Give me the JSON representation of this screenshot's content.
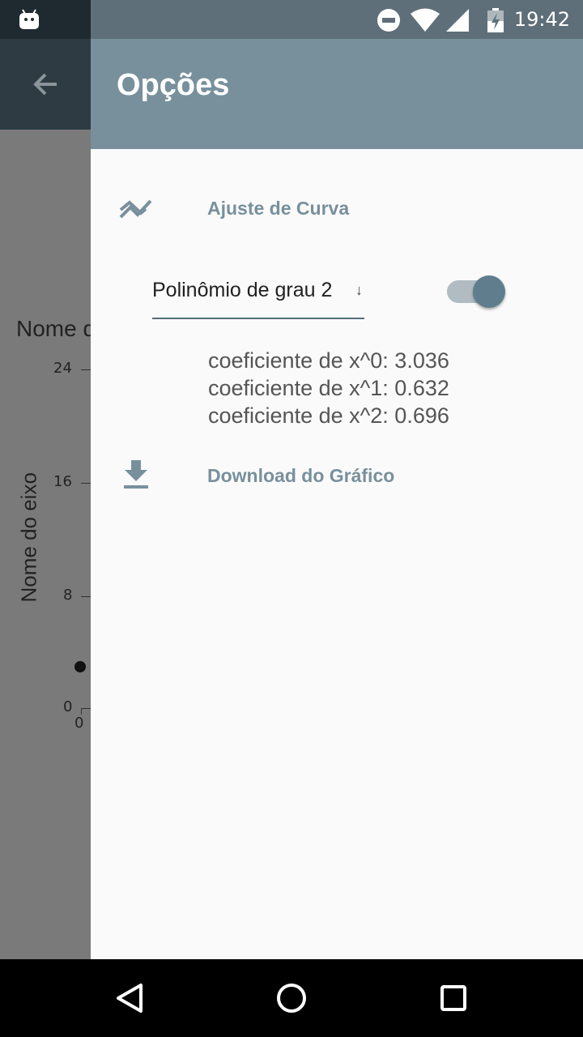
{
  "status_bar": {
    "time": "19:42",
    "icons": [
      "android-icon",
      "dnd-icon",
      "wifi-icon",
      "signal-icon",
      "battery-charging-icon"
    ]
  },
  "background_chart": {
    "title_fragment": "Nome d",
    "y_axis_label": "Nome do eixo",
    "y_ticks": [
      "24",
      "16",
      "8",
      "0"
    ],
    "x_ticks": [
      "0"
    ]
  },
  "drawer": {
    "title": "Opções",
    "curve_fit": {
      "label": "Ajuste de Curva",
      "icon": "trend-icon",
      "select_value": "Polinômio de grau 2",
      "toggle_on": true,
      "coefficients": [
        "coeficiente de x^0: 3.036",
        "coeficiente de x^1: 0.632",
        "coeficiente de x^2: 0.696"
      ]
    },
    "download": {
      "label": "Download do Gráfico",
      "icon": "download-icon"
    }
  },
  "colors": {
    "accent": "#78909c",
    "header": "#78909c",
    "toolbar": "#2e3b42"
  },
  "nav_bar": {
    "buttons": [
      "back-icon",
      "home-icon",
      "recents-icon"
    ]
  }
}
